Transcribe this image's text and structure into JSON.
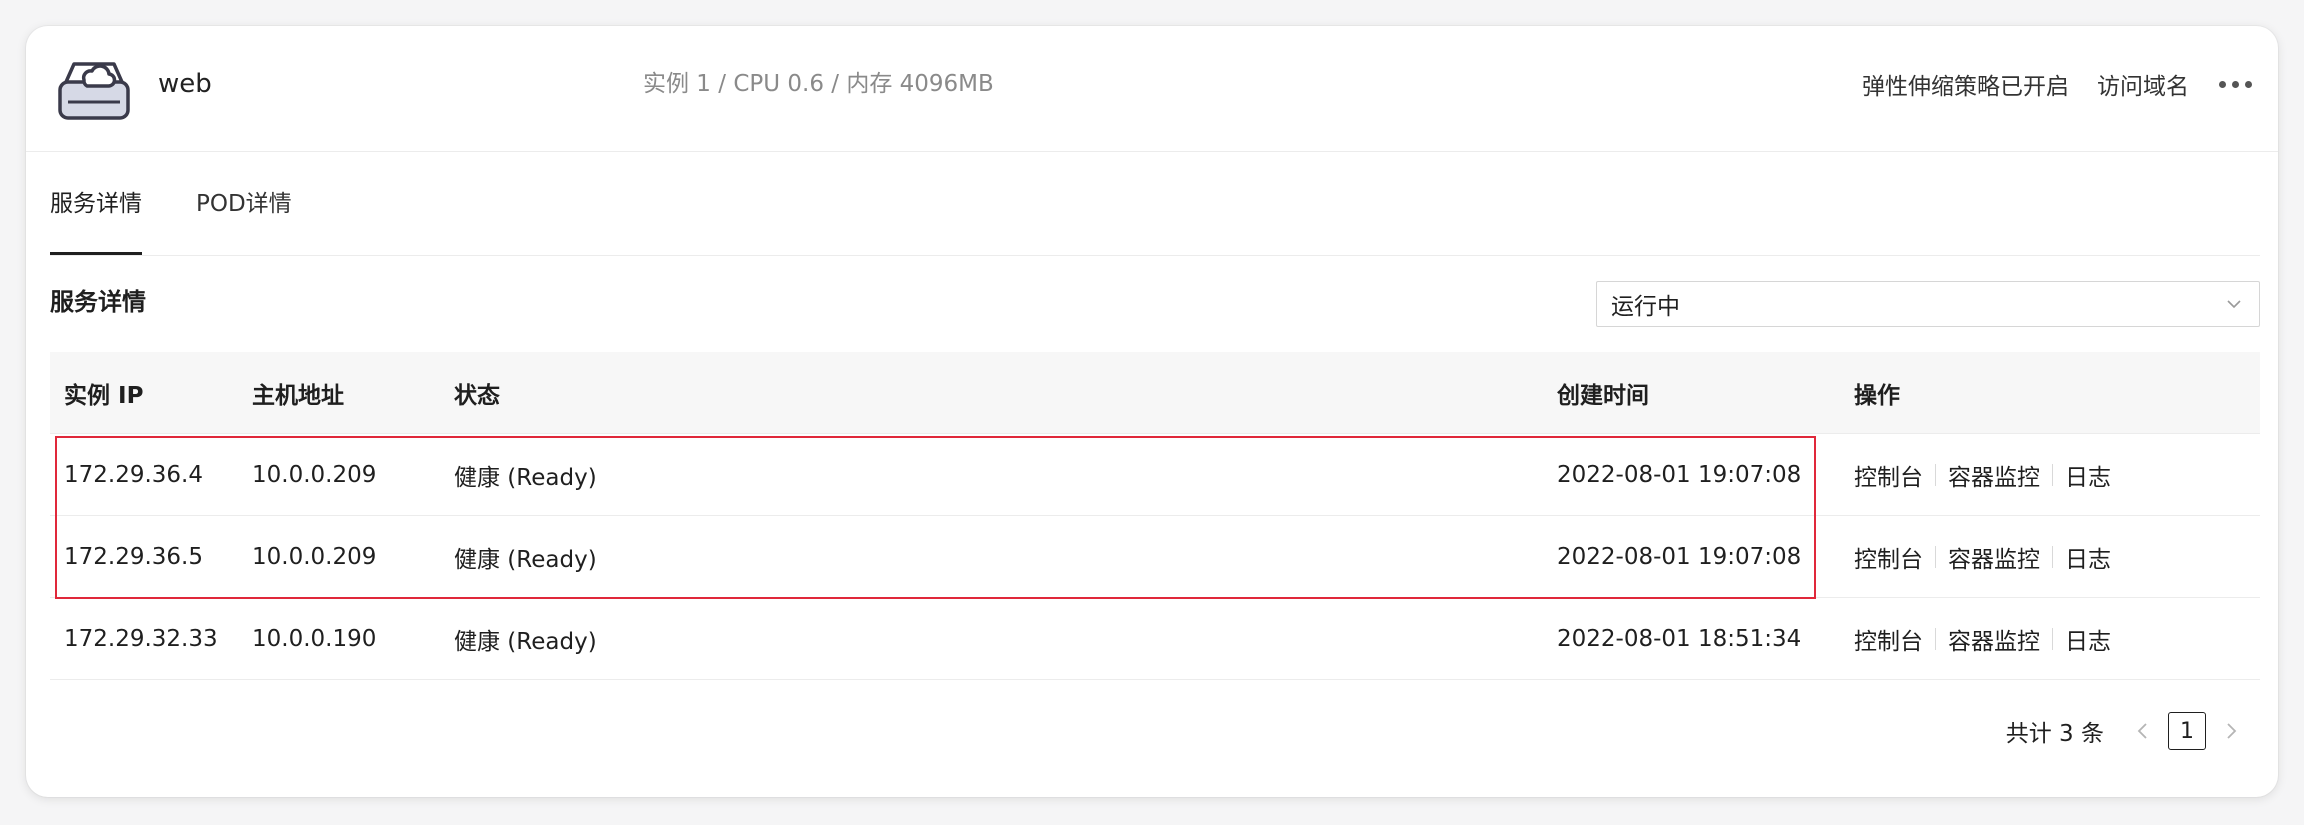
{
  "header": {
    "service_name": "web",
    "summary": "实例 1 / CPU 0.6 / 内存 4096MB",
    "autoscale_label": "弹性伸缩策略已开启",
    "domain_label": "访问域名",
    "icon": "server-cloud-icon"
  },
  "tabs": [
    {
      "label": "服务详情",
      "active": true
    },
    {
      "label": "POD详情",
      "active": false
    }
  ],
  "section": {
    "title": "服务详情",
    "filter_value": "运行中"
  },
  "table": {
    "columns": [
      "实例 IP",
      "主机地址",
      "状态",
      "创建时间",
      "操作"
    ],
    "rows": [
      {
        "ip": "172.29.36.4",
        "host": "10.0.0.209",
        "status": "健康 (Ready)",
        "created": "2022-08-01 19:07:08"
      },
      {
        "ip": "172.29.36.5",
        "host": "10.0.0.209",
        "status": "健康 (Ready)",
        "created": "2022-08-01 19:07:08"
      },
      {
        "ip": "172.29.32.33",
        "host": "10.0.0.190",
        "status": "健康 (Ready)",
        "created": "2022-08-01 18:51:34"
      }
    ],
    "ops": [
      "控制台",
      "容器监控",
      "日志"
    ]
  },
  "pagination": {
    "total_text": "共计 3 条",
    "current_page": "1"
  },
  "colors": {
    "highlight": "#e0283a",
    "header_bg": "#f7f7f7",
    "border": "#ececec"
  }
}
